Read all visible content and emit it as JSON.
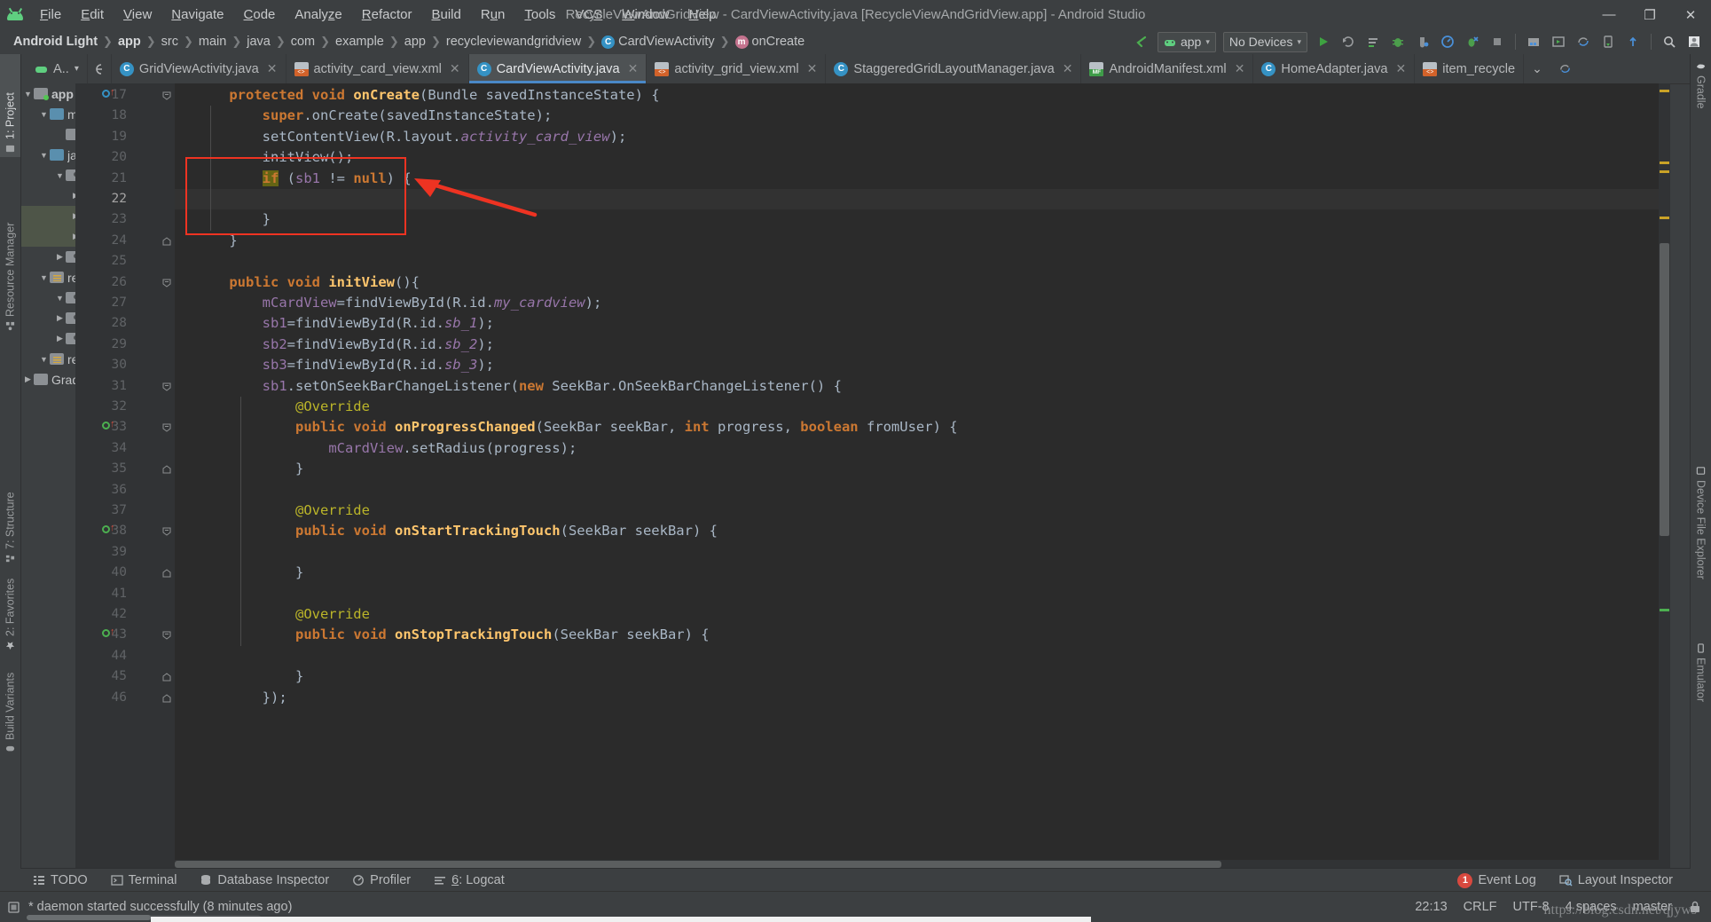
{
  "window": {
    "title": "RecycleViewAndGridView - CardViewActivity.java [RecycleViewAndGridView.app] - Android Studio",
    "minimize_label": "—",
    "maximize_label": "❐",
    "close_label": "✕",
    "logo_name": "android-studio-logo"
  },
  "menubar": {
    "items": [
      {
        "label": "File",
        "mnemonic": "F"
      },
      {
        "label": "Edit",
        "mnemonic": "E"
      },
      {
        "label": "View",
        "mnemonic": "V"
      },
      {
        "label": "Navigate",
        "mnemonic": "N"
      },
      {
        "label": "Code",
        "mnemonic": "C"
      },
      {
        "label": "Analyze",
        "mnemonic": "z"
      },
      {
        "label": "Refactor",
        "mnemonic": "R"
      },
      {
        "label": "Build",
        "mnemonic": "B"
      },
      {
        "label": "Run",
        "mnemonic": "u"
      },
      {
        "label": "Tools",
        "mnemonic": "T"
      },
      {
        "label": "VCS",
        "mnemonic": "S"
      },
      {
        "label": "Window",
        "mnemonic": "W"
      },
      {
        "label": "Help",
        "mnemonic": "H"
      }
    ]
  },
  "breadcrumbs": [
    {
      "label": "Android Light",
      "type": "project",
      "bold": true
    },
    {
      "label": "app",
      "type": "module",
      "bold": true
    },
    {
      "label": "src",
      "type": "dir"
    },
    {
      "label": "main",
      "type": "dir"
    },
    {
      "label": "java",
      "type": "dir"
    },
    {
      "label": "com",
      "type": "dir"
    },
    {
      "label": "example",
      "type": "dir"
    },
    {
      "label": "app",
      "type": "dir"
    },
    {
      "label": "recycleviewandgridview",
      "type": "dir"
    },
    {
      "label": "CardViewActivity",
      "type": "class",
      "icon": "C"
    },
    {
      "label": "onCreate",
      "type": "method",
      "icon": "m"
    }
  ],
  "toolbar": {
    "run_config_label": "app",
    "device_label": "No Devices",
    "caret": "▾",
    "icons": [
      "run-icon",
      "rerun-icon",
      "apply-changes-icon",
      "debug-icon",
      "attach-debugger-icon",
      "profile-icon",
      "apply-code-changes-icon",
      "stop-icon",
      "sdk-manager-icon",
      "avd-manager-icon",
      "sync-gradle-icon",
      "device-file-explorer-icon",
      "upload-icon",
      "search-icon",
      "user-avatar-icon"
    ],
    "back_arrow": "↖"
  },
  "tabs": [
    {
      "label": "GridViewActivity.java",
      "icon": "java",
      "active": false,
      "closable": true
    },
    {
      "label": "activity_card_view.xml",
      "icon": "xml",
      "active": false,
      "closable": true
    },
    {
      "label": "CardViewActivity.java",
      "icon": "java",
      "active": true,
      "closable": true
    },
    {
      "label": "activity_grid_view.xml",
      "icon": "xml",
      "active": false,
      "closable": true
    },
    {
      "label": "StaggeredGridLayoutManager.java",
      "icon": "java",
      "active": false,
      "closable": true
    },
    {
      "label": "AndroidManifest.xml",
      "icon": "mf",
      "active": false,
      "closable": true
    },
    {
      "label": "HomeAdapter.java",
      "icon": "java",
      "active": false,
      "closable": true
    },
    {
      "label": "item_recycle",
      "icon": "xml",
      "active": false,
      "closable": false
    }
  ],
  "tabbar": {
    "overflow_label": "⌄",
    "app_selector_label": "A..",
    "app_selector_caret": "▾"
  },
  "left_tool_strip": [
    {
      "label": "1: Project",
      "mnemonic": "1",
      "icon": "project-icon",
      "selected": true
    },
    {
      "label": "Resource Manager",
      "icon": "resource-manager-icon",
      "selected": false
    },
    {
      "label": "7: Structure",
      "mnemonic": "7",
      "icon": "structure-icon",
      "selected": false
    },
    {
      "label": "2: Favorites",
      "mnemonic": "2",
      "icon": "star-icon",
      "selected": false
    },
    {
      "label": "Build Variants",
      "icon": "android-icon",
      "selected": false
    }
  ],
  "right_tool_strip": [
    {
      "label": "Gradle",
      "icon": "gradle-elephant-icon"
    },
    {
      "label": "Device File Explorer",
      "icon": "device-icon"
    },
    {
      "label": "Emulator",
      "icon": "emulator-icon"
    }
  ],
  "project_tree": [
    {
      "indent": 0,
      "twist": "▼",
      "label": "app",
      "icon": "module-folder",
      "bold": true
    },
    {
      "indent": 1,
      "twist": "▼",
      "label": "ma",
      "icon": "blue-folder"
    },
    {
      "indent": 2,
      "twist": "",
      "label": "",
      "icon": "manifest-file"
    },
    {
      "indent": 1,
      "twist": "▼",
      "label": "jav",
      "icon": "blue-folder"
    },
    {
      "indent": 2,
      "twist": "▼",
      "label": "",
      "icon": "package-folder"
    },
    {
      "indent": 3,
      "twist": "▶",
      "label": "",
      "icon": "package-folder"
    },
    {
      "indent": 3,
      "twist": "▶",
      "label": "",
      "icon": "package-folder",
      "highlight": true
    },
    {
      "indent": 3,
      "twist": "▶",
      "label": "",
      "icon": "package-folder",
      "highlight": true
    },
    {
      "indent": 2,
      "twist": "▶",
      "label": "jav",
      "icon": "test-folder"
    },
    {
      "indent": 1,
      "twist": "▼",
      "label": "res",
      "icon": "res-folder"
    },
    {
      "indent": 2,
      "twist": "▼",
      "label": "",
      "icon": "package-folder"
    },
    {
      "indent": 2,
      "twist": "▶",
      "label": "",
      "icon": "package-folder"
    },
    {
      "indent": 2,
      "twist": "▶",
      "label": "",
      "icon": "package-folder"
    },
    {
      "indent": 1,
      "twist": "▼",
      "label": "res",
      "icon": "res-folder"
    },
    {
      "indent": 0,
      "twist": "▶",
      "label": "Gradl",
      "icon": "gradle-icon"
    }
  ],
  "editor": {
    "filename": "CardViewActivity.java",
    "first_line": 17,
    "lines": [
      {
        "n": 17,
        "indent": 1,
        "gutter": "breakpoint-override",
        "fold": "minus",
        "tokens": [
          {
            "t": "protected",
            "c": "kw"
          },
          {
            "t": " ",
            "c": "pl"
          },
          {
            "t": "void",
            "c": "kw"
          },
          {
            "t": " ",
            "c": "pl"
          },
          {
            "t": "onCreate",
            "c": "fnb"
          },
          {
            "t": "(Bundle savedInstanceState) {",
            "c": "pl"
          }
        ]
      },
      {
        "n": 18,
        "indent": 2,
        "tokens": [
          {
            "t": "super",
            "c": "kw"
          },
          {
            "t": ".onCreate(savedInstanceState);",
            "c": "pl"
          }
        ]
      },
      {
        "n": 19,
        "indent": 2,
        "tokens": [
          {
            "t": "setContentView(R.layout.",
            "c": "pl"
          },
          {
            "t": "activity_card_view",
            "c": "fldi"
          },
          {
            "t": ");",
            "c": "pl"
          }
        ]
      },
      {
        "n": 20,
        "indent": 2,
        "tokens": [
          {
            "t": "initView();",
            "c": "pl"
          }
        ]
      },
      {
        "n": 21,
        "indent": 2,
        "boxed": true,
        "tokens": [
          {
            "t": "if",
            "c": "kw hl-ident"
          },
          {
            "t": " (",
            "c": "pl"
          },
          {
            "t": "sb1",
            "c": "fld"
          },
          {
            "t": " != ",
            "c": "pl"
          },
          {
            "t": "null",
            "c": "kw"
          },
          {
            "t": ") {",
            "c": "pl"
          }
        ]
      },
      {
        "n": 22,
        "indent": 2,
        "boxed": true,
        "current": true,
        "tokens": []
      },
      {
        "n": 23,
        "indent": 2,
        "boxed": true,
        "tokens": [
          {
            "t": "}",
            "c": "pl"
          }
        ]
      },
      {
        "n": 24,
        "indent": 1,
        "fold": "minus-end",
        "tokens": [
          {
            "t": "}",
            "c": "pl"
          }
        ]
      },
      {
        "n": 25,
        "indent": 0,
        "tokens": []
      },
      {
        "n": 26,
        "indent": 1,
        "fold": "minus",
        "tokens": [
          {
            "t": "public",
            "c": "kw"
          },
          {
            "t": " ",
            "c": "pl"
          },
          {
            "t": "void",
            "c": "kw"
          },
          {
            "t": " ",
            "c": "pl"
          },
          {
            "t": "initView",
            "c": "fnb"
          },
          {
            "t": "(){",
            "c": "pl"
          }
        ]
      },
      {
        "n": 27,
        "indent": 2,
        "tokens": [
          {
            "t": "mCardView",
            "c": "fld"
          },
          {
            "t": "=findViewById(R.id.",
            "c": "pl"
          },
          {
            "t": "my_cardview",
            "c": "fldi"
          },
          {
            "t": ");",
            "c": "pl"
          }
        ]
      },
      {
        "n": 28,
        "indent": 2,
        "tokens": [
          {
            "t": "sb1",
            "c": "fld"
          },
          {
            "t": "=findViewById(R.id.",
            "c": "pl"
          },
          {
            "t": "sb_1",
            "c": "fldi"
          },
          {
            "t": ");",
            "c": "pl"
          }
        ]
      },
      {
        "n": 29,
        "indent": 2,
        "tokens": [
          {
            "t": "sb2",
            "c": "fld"
          },
          {
            "t": "=findViewById(R.id.",
            "c": "pl"
          },
          {
            "t": "sb_2",
            "c": "fldi"
          },
          {
            "t": ");",
            "c": "pl"
          }
        ]
      },
      {
        "n": 30,
        "indent": 2,
        "tokens": [
          {
            "t": "sb3",
            "c": "fld"
          },
          {
            "t": "=findViewById(R.id.",
            "c": "pl"
          },
          {
            "t": "sb_3",
            "c": "fldi"
          },
          {
            "t": ");",
            "c": "pl"
          }
        ]
      },
      {
        "n": 31,
        "indent": 2,
        "fold": "minus",
        "tokens": [
          {
            "t": "sb1",
            "c": "fld"
          },
          {
            "t": ".setOnSeekBarChangeListener(",
            "c": "pl"
          },
          {
            "t": "new",
            "c": "kw"
          },
          {
            "t": " SeekBar.OnSeekBarChangeListener() {",
            "c": "pl"
          }
        ]
      },
      {
        "n": 32,
        "indent": 3,
        "tokens": [
          {
            "t": "@Override",
            "c": "ann"
          }
        ]
      },
      {
        "n": 33,
        "indent": 3,
        "gutter": "override-green",
        "fold": "minus",
        "tokens": [
          {
            "t": "public",
            "c": "kw"
          },
          {
            "t": " ",
            "c": "pl"
          },
          {
            "t": "void",
            "c": "kw"
          },
          {
            "t": " ",
            "c": "pl"
          },
          {
            "t": "onProgressChanged",
            "c": "fnb"
          },
          {
            "t": "(SeekBar seekBar, ",
            "c": "pl"
          },
          {
            "t": "int",
            "c": "kw"
          },
          {
            "t": " progress, ",
            "c": "pl"
          },
          {
            "t": "boolean",
            "c": "kw"
          },
          {
            "t": " fromUser) {",
            "c": "pl"
          }
        ]
      },
      {
        "n": 34,
        "indent": 4,
        "tokens": [
          {
            "t": "mCardView",
            "c": "fld"
          },
          {
            "t": ".setRadius(progress);",
            "c": "pl"
          }
        ]
      },
      {
        "n": 35,
        "indent": 3,
        "fold": "minus-end",
        "tokens": [
          {
            "t": "}",
            "c": "pl"
          }
        ]
      },
      {
        "n": 36,
        "indent": 0,
        "tokens": []
      },
      {
        "n": 37,
        "indent": 3,
        "tokens": [
          {
            "t": "@Override",
            "c": "ann"
          }
        ]
      },
      {
        "n": 38,
        "indent": 3,
        "gutter": "override-green",
        "fold": "minus",
        "tokens": [
          {
            "t": "public",
            "c": "kw"
          },
          {
            "t": " ",
            "c": "pl"
          },
          {
            "t": "void",
            "c": "kw"
          },
          {
            "t": " ",
            "c": "pl"
          },
          {
            "t": "onStartTrackingTouch",
            "c": "fnb"
          },
          {
            "t": "(SeekBar seekBar) {",
            "c": "pl"
          }
        ]
      },
      {
        "n": 39,
        "indent": 0,
        "tokens": []
      },
      {
        "n": 40,
        "indent": 3,
        "fold": "minus-end",
        "tokens": [
          {
            "t": "}",
            "c": "pl"
          }
        ]
      },
      {
        "n": 41,
        "indent": 0,
        "tokens": []
      },
      {
        "n": 42,
        "indent": 3,
        "tokens": [
          {
            "t": "@Override",
            "c": "ann"
          }
        ]
      },
      {
        "n": 43,
        "indent": 3,
        "gutter": "override-green",
        "fold": "minus",
        "tokens": [
          {
            "t": "public",
            "c": "kw"
          },
          {
            "t": " ",
            "c": "pl"
          },
          {
            "t": "void",
            "c": "kw"
          },
          {
            "t": " ",
            "c": "pl"
          },
          {
            "t": "onStopTrackingTouch",
            "c": "fnb"
          },
          {
            "t": "(SeekBar seekBar) {",
            "c": "pl"
          }
        ]
      },
      {
        "n": 44,
        "indent": 0,
        "tokens": []
      },
      {
        "n": 45,
        "indent": 3,
        "fold": "minus-end",
        "tokens": [
          {
            "t": "}",
            "c": "pl"
          }
        ]
      },
      {
        "n": 46,
        "indent": 2,
        "fold": "minus-end",
        "tokens": [
          {
            "t": "});",
            "c": "pl"
          }
        ]
      }
    ],
    "annotation": {
      "type": "red-box-with-arrow",
      "color": "#ee3322",
      "note": "highlights the if (sb1 != null) block"
    }
  },
  "bottom_tool_windows": [
    {
      "label": "TODO",
      "icon": "todo-icon"
    },
    {
      "label": "Terminal",
      "icon": "terminal-icon"
    },
    {
      "label": "Database Inspector",
      "icon": "database-icon"
    },
    {
      "label": "Profiler",
      "icon": "profiler-icon"
    },
    {
      "label": "6: Logcat",
      "mnemonic": "6",
      "icon": "logcat-icon"
    }
  ],
  "bottom_right_tool_windows": [
    {
      "label": "Event Log",
      "icon": "event-log-icon",
      "badge": "1"
    },
    {
      "label": "Layout Inspector",
      "icon": "layout-inspector-icon"
    }
  ],
  "statusbar": {
    "message": "* daemon started successfully (8 minutes ago)",
    "message_icon": "memory-indicator-icon",
    "time": "22:13",
    "line_separator": "CRLF",
    "encoding": "UTF-8",
    "indent": "4 spaces",
    "branch": "master",
    "lock_icon": "read-only-icon",
    "watermark": "https://blog.csdn.net/qjyws"
  },
  "colors": {
    "accent_blue": "#4a88c7",
    "annotation_red": "#ee3322",
    "editor_bg": "#2b2b2b",
    "chrome_bg": "#3c3f41",
    "gutter_bg": "#313335",
    "keyword": "#cc7832",
    "method": "#ffc66d",
    "field": "#9876aa",
    "annotation_token": "#bbb529",
    "plain": "#a9b7c6",
    "badge_red": "#d8493f",
    "android_green": "#5fcf80"
  }
}
